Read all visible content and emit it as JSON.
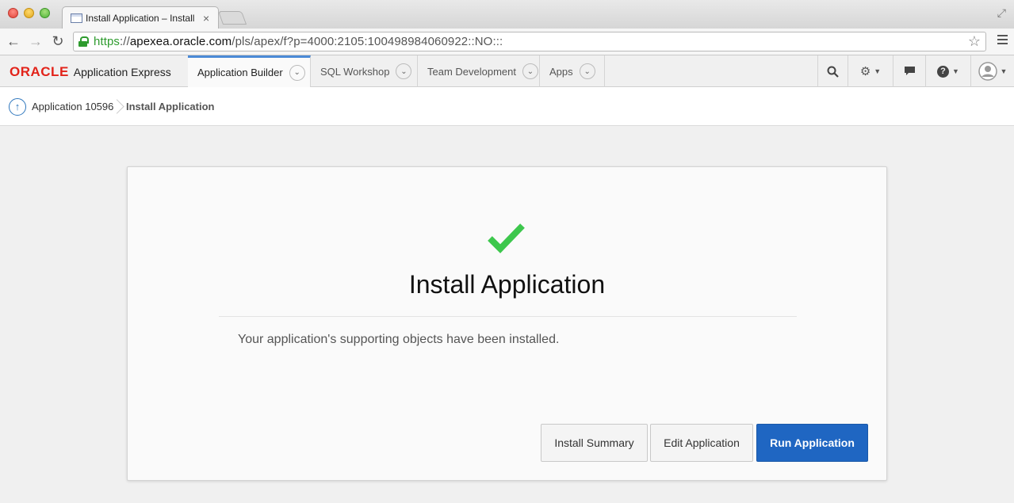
{
  "browser": {
    "tab_title": "Install Application – Install",
    "tab_close": "×",
    "url_scheme": "https",
    "url_sep": "://",
    "url_host": "apexea.oracle.com",
    "url_path": "/pls/apex/f?p=4000:2105:100498984060922::NO:::",
    "back_glyph": "←",
    "forward_glyph": "→",
    "reload_glyph": "↻",
    "star_glyph": "☆",
    "resize_glyph": "⤢"
  },
  "header": {
    "logo_brand": "ORACLE",
    "logo_product": "Application Express",
    "tabs": [
      {
        "label": "Application Builder"
      },
      {
        "label": "SQL Workshop"
      },
      {
        "label": "Team Development"
      },
      {
        "label": "Apps"
      }
    ],
    "chevron_glyph": "⌄",
    "search_glyph": "⌕",
    "admin_glyph": "⚙",
    "chat_glyph": "▬",
    "help_glyph": "?",
    "caret_glyph": "▼"
  },
  "breadcrumb": {
    "up_glyph": "↑",
    "parent": "Application 10596",
    "current": "Install Application"
  },
  "dialog": {
    "title": "Install Application",
    "message": "Your application's supporting objects have been installed.",
    "success_color": "#3dc74d",
    "buttons": {
      "install_summary": "Install Summary",
      "edit_application": "Edit Application",
      "run_application": "Run Application"
    }
  }
}
